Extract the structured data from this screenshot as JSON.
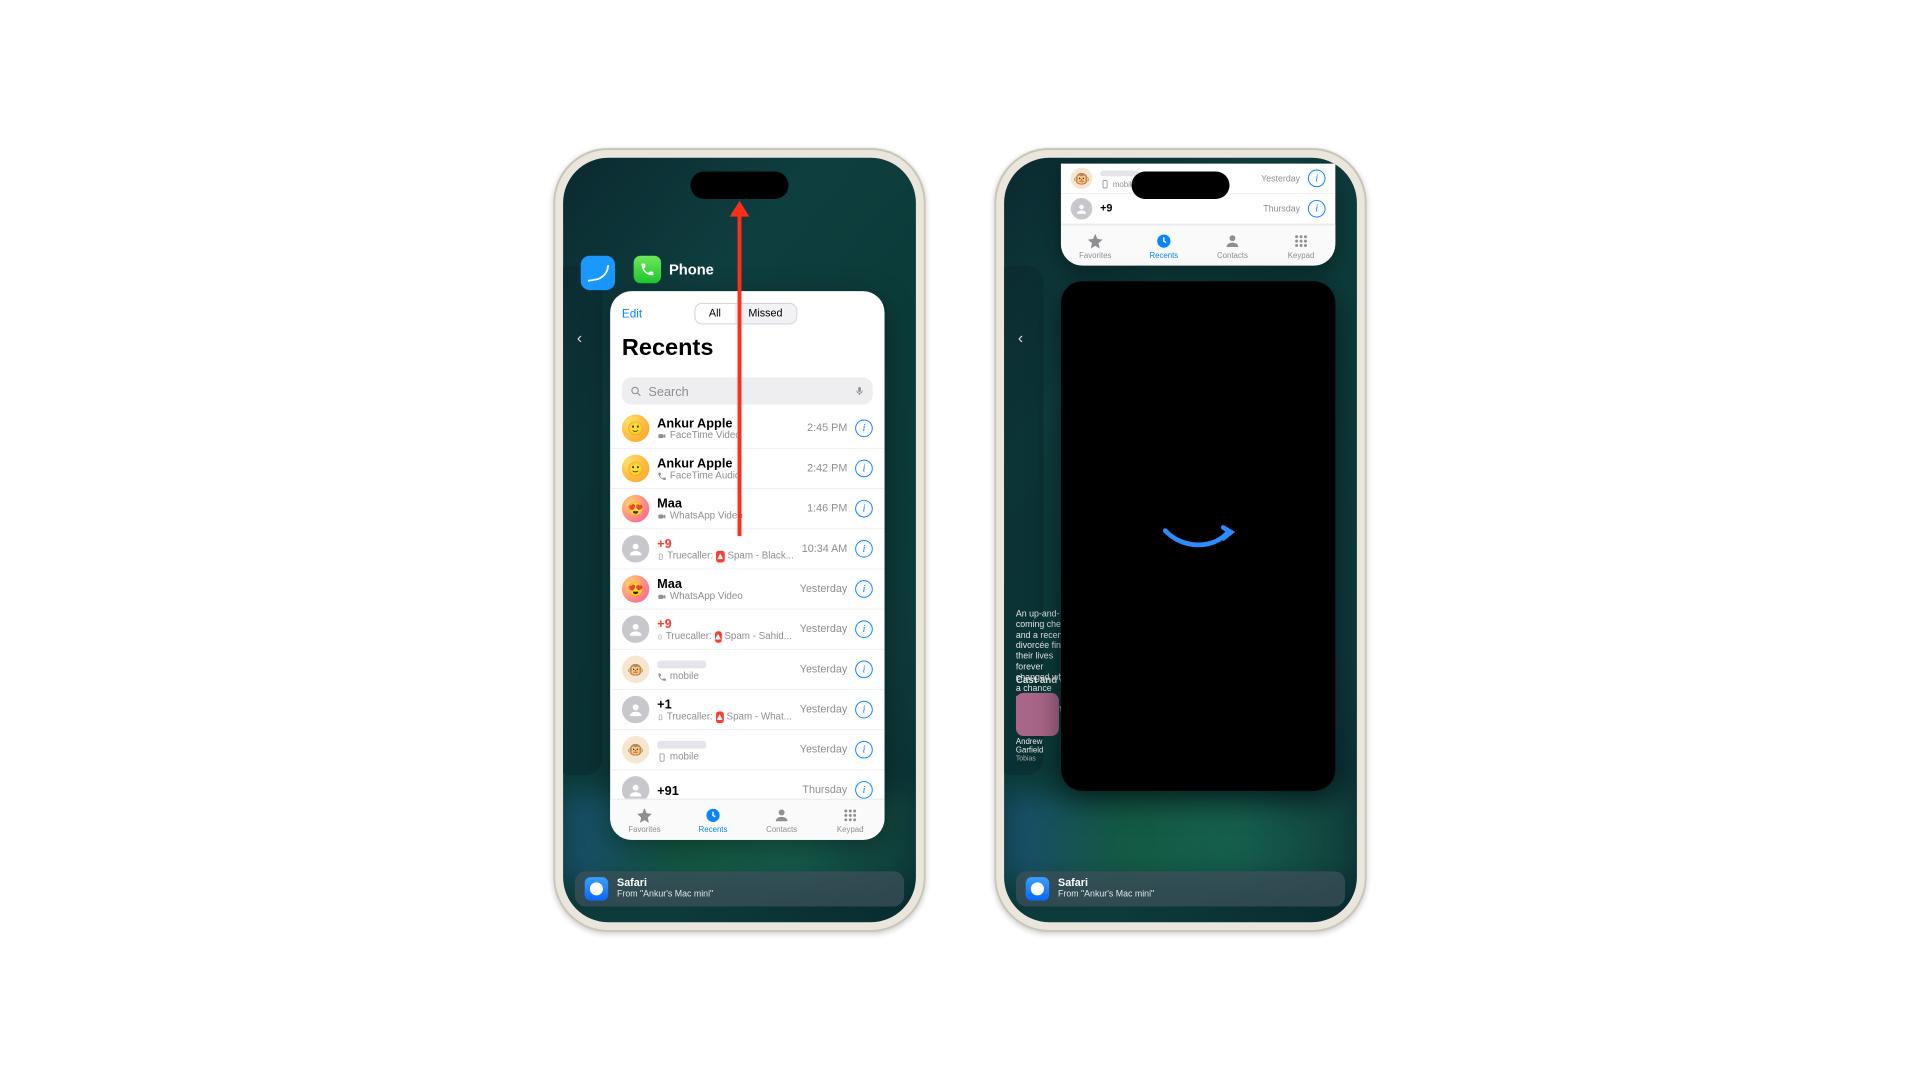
{
  "app": {
    "name": "Phone"
  },
  "header": {
    "edit": "Edit",
    "seg_all": "All",
    "seg_missed": "Missed",
    "title": "Recents"
  },
  "search": {
    "placeholder": "Search"
  },
  "rows": [
    {
      "name": "Ankur Apple",
      "sub": "FaceTime Video",
      "time": "2:45 PM",
      "missed": false,
      "avatar": "orange",
      "subicon": "video"
    },
    {
      "name": "Ankur Apple",
      "sub": "FaceTime Audio",
      "time": "2:42 PM",
      "missed": false,
      "avatar": "orange",
      "subicon": "phone"
    },
    {
      "name": "Maa",
      "sub": "WhatsApp Video",
      "time": "1:46 PM",
      "missed": false,
      "avatar": "pink",
      "subicon": "video"
    },
    {
      "name": "+9",
      "sub": "Truecaller:  Spam - Black...",
      "time": "10:34 AM",
      "missed": true,
      "avatar": "gray",
      "subicon": "tc"
    },
    {
      "name": "Maa",
      "sub": "WhatsApp Video",
      "time": "Yesterday",
      "missed": false,
      "avatar": "pink",
      "subicon": "video"
    },
    {
      "name": "+9",
      "sub": "Truecaller:  Spam - Sahid...",
      "time": "Yesterday",
      "missed": true,
      "avatar": "gray",
      "subicon": "tc"
    },
    {
      "name": "",
      "sub": "mobile",
      "time": "Yesterday",
      "missed": false,
      "avatar": "monkey",
      "subicon": "phone"
    },
    {
      "name": "+1",
      "sub": "Truecaller:  Spam - What...",
      "time": "Yesterday",
      "missed": false,
      "avatar": "gray",
      "subicon": "tc"
    },
    {
      "name": "",
      "sub": "mobile",
      "time": "Yesterday",
      "missed": false,
      "avatar": "monkey",
      "subicon": "mobile"
    },
    {
      "name": "+91",
      "sub": "",
      "time": "Thursday",
      "missed": false,
      "avatar": "gray",
      "subicon": ""
    }
  ],
  "tabs": {
    "favorites": "Favorites",
    "recents": "Recents",
    "contacts": "Contacts",
    "keypad": "Keypad"
  },
  "handoff": {
    "app": "Safari",
    "from": "From \"Ankur's Mac mini\""
  },
  "right": {
    "stub": [
      {
        "name": "",
        "sub": "mobile",
        "time": "Yesterday",
        "avatar": "monkey"
      },
      {
        "name": "+9",
        "sub": "",
        "time": "Thursday",
        "avatar": "gray"
      }
    ],
    "side_text": "An up-and-coming chef and a recent divorcée find their lives forever changed when a chance encounter brings them together.",
    "cast_label": "Cast and crew",
    "actor_name": "Andrew Garfield",
    "actor_role": "Tobias"
  }
}
